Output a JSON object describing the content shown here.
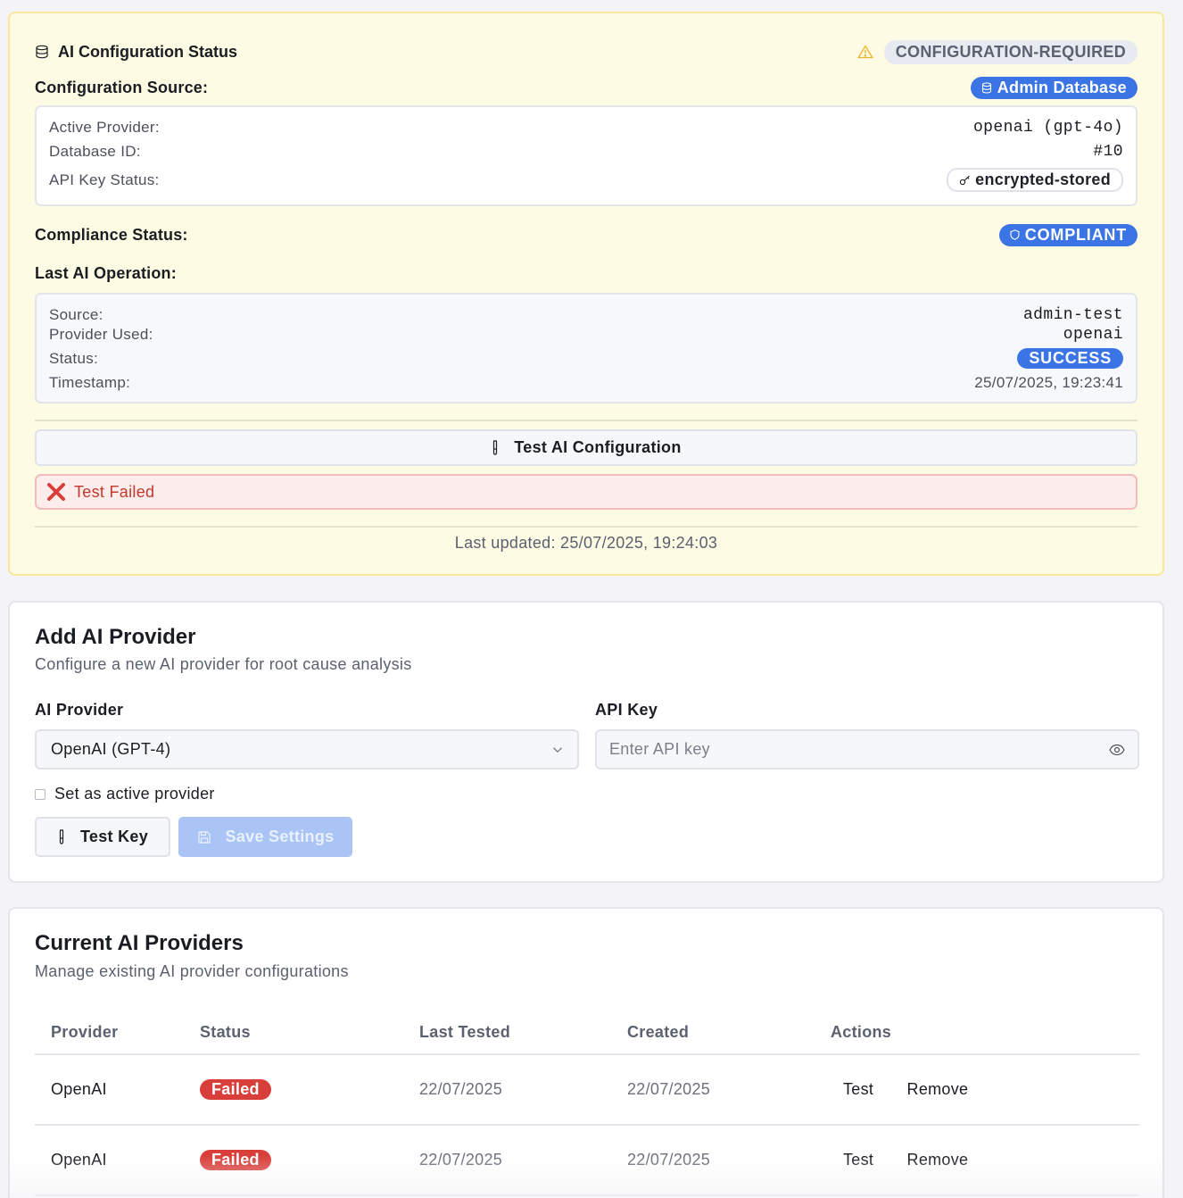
{
  "status_card": {
    "title": "AI Configuration Status",
    "state_badge": "CONFIGURATION-REQUIRED",
    "config_source_label": "Configuration Source:",
    "config_source_badge": "Admin Database",
    "active": {
      "provider_label": "Active Provider:",
      "provider_value": "openai (gpt-4o)",
      "db_id_label": "Database ID:",
      "db_id_value": "#10",
      "key_status_label": "API Key Status:",
      "key_status_value": "encrypted-stored"
    },
    "compliance_label": "Compliance Status:",
    "compliance_badge": "COMPLIANT",
    "last_op_label": "Last AI Operation:",
    "last_op": {
      "source_label": "Source:",
      "source_value": "admin-test",
      "provider_label": "Provider Used:",
      "provider_value": "openai",
      "status_label": "Status:",
      "status_value": "SUCCESS",
      "timestamp_label": "Timestamp:",
      "timestamp_value": "25/07/2025, 19:23:41"
    },
    "test_button": "Test AI Configuration",
    "test_result": "Test Failed",
    "last_updated": "Last updated: 25/07/2025, 19:24:03"
  },
  "add_provider": {
    "title": "Add AI Provider",
    "subtitle": "Configure a new AI provider for root cause analysis",
    "provider_label": "AI Provider",
    "provider_value": "OpenAI (GPT-4)",
    "api_key_label": "API Key",
    "api_key_placeholder": "Enter API key",
    "active_checkbox_label": "Set as active provider",
    "test_key_button": "Test Key",
    "save_button": "Save Settings"
  },
  "current_providers": {
    "title": "Current AI Providers",
    "subtitle": "Manage existing AI provider configurations",
    "columns": [
      "Provider",
      "Status",
      "Last Tested",
      "Created",
      "Actions"
    ],
    "rows": [
      {
        "provider": "OpenAI",
        "status": "Failed",
        "last_tested": "22/07/2025",
        "created": "22/07/2025",
        "test": "Test",
        "remove": "Remove"
      },
      {
        "provider": "OpenAI",
        "status": "Failed",
        "last_tested": "22/07/2025",
        "created": "22/07/2025",
        "test": "Test",
        "remove": "Remove"
      }
    ]
  },
  "colors": {
    "accent_blue": "#3b74e4",
    "status_bg": "#fefbe4",
    "failed_red": "#d93f3a",
    "error_bg": "#fdecec"
  }
}
